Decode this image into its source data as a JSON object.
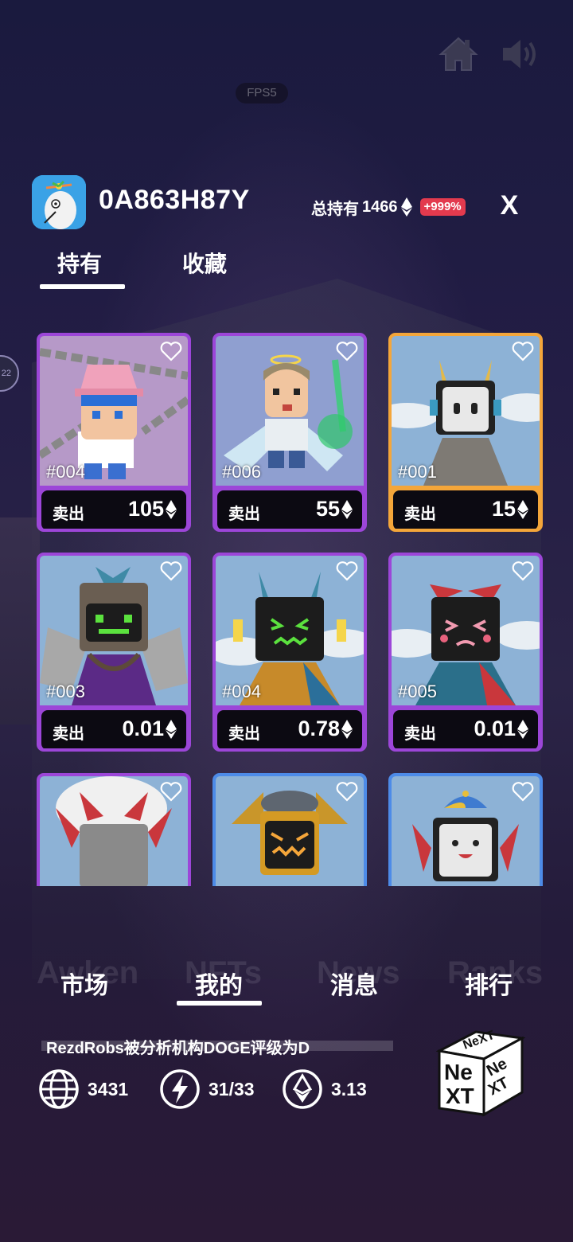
{
  "top": {
    "home_icon": "home-icon",
    "sound_icon": "speaker-icon",
    "fps_label": "FPS5",
    "side_badge": "22"
  },
  "header": {
    "username": "0A863H87Y",
    "holdings_label": "总持有",
    "holdings_value": "1466",
    "holdings_change": "+999%",
    "close_label": "X"
  },
  "tabs": [
    {
      "label": "持有",
      "active": true
    },
    {
      "label": "收藏",
      "active": false
    }
  ],
  "cards": [
    {
      "id": "#004",
      "sell_label": "卖出",
      "price": "105"
    },
    {
      "id": "#006",
      "sell_label": "卖出",
      "price": "55"
    },
    {
      "id": "#001",
      "sell_label": "卖出",
      "price": "15"
    },
    {
      "id": "#003",
      "sell_label": "卖出",
      "price": "0.01"
    },
    {
      "id": "#004",
      "sell_label": "卖出",
      "price": "0.78"
    },
    {
      "id": "#005",
      "sell_label": "卖出",
      "price": "0.01"
    },
    {
      "id": "",
      "sell_label": "",
      "price": ""
    },
    {
      "id": "",
      "sell_label": "",
      "price": ""
    },
    {
      "id": "",
      "sell_label": "",
      "price": ""
    }
  ],
  "bottom_nav": [
    {
      "label": "市场",
      "active": false
    },
    {
      "label": "我的",
      "active": true
    },
    {
      "label": "消息",
      "active": false
    },
    {
      "label": "排行",
      "active": false
    }
  ],
  "background_ghost_text": [
    "Awken",
    "NFTs",
    "News",
    "Ranks"
  ],
  "ticker": "RezdRobs被分析机构DOGE评级为D",
  "stats": {
    "globe": "3431",
    "energy": "31/33",
    "eth": "3.13"
  },
  "colors": {
    "card_border_purple": "#9c46d8",
    "card_border_gold": "#f4a63a",
    "card_border_blue": "#4d8be8",
    "change_badge": "#e33a4e"
  }
}
